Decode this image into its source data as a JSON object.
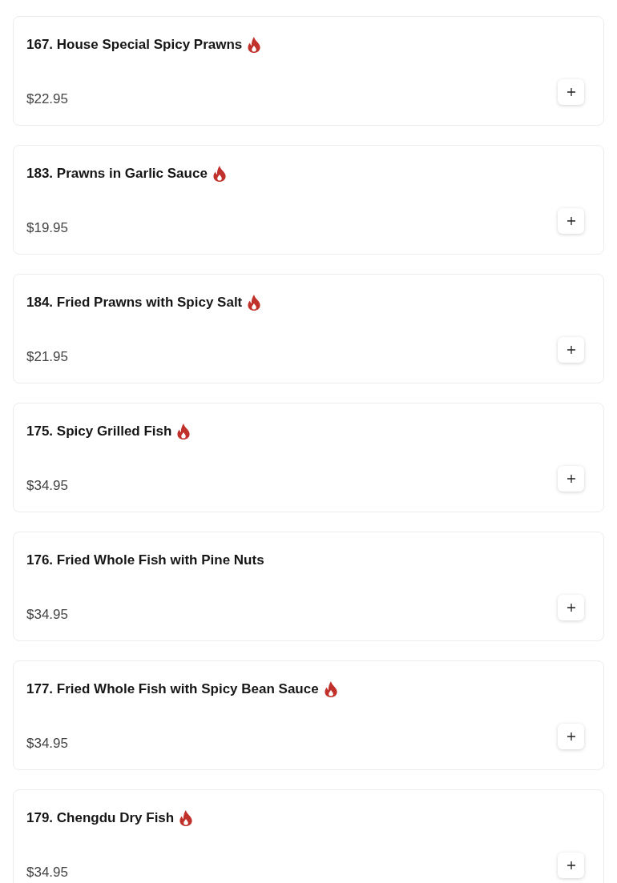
{
  "menu_items": [
    {
      "name": "167. House Special Spicy Prawns",
      "spicy": true,
      "price": "$22.95"
    },
    {
      "name": "183. Prawns in Garlic Sauce",
      "spicy": true,
      "price": "$19.95"
    },
    {
      "name": "184. Fried Prawns with Spicy Salt",
      "spicy": true,
      "price": "$21.95"
    },
    {
      "name": "175. Spicy Grilled Fish",
      "spicy": true,
      "price": "$34.95"
    },
    {
      "name": "176. Fried Whole Fish with Pine Nuts",
      "spicy": false,
      "price": "$34.95"
    },
    {
      "name": "177. Fried Whole Fish with Spicy Bean Sauce",
      "spicy": true,
      "price": "$34.95"
    },
    {
      "name": "179. Chengdu Dry Fish",
      "spicy": true,
      "price": "$34.95"
    }
  ]
}
